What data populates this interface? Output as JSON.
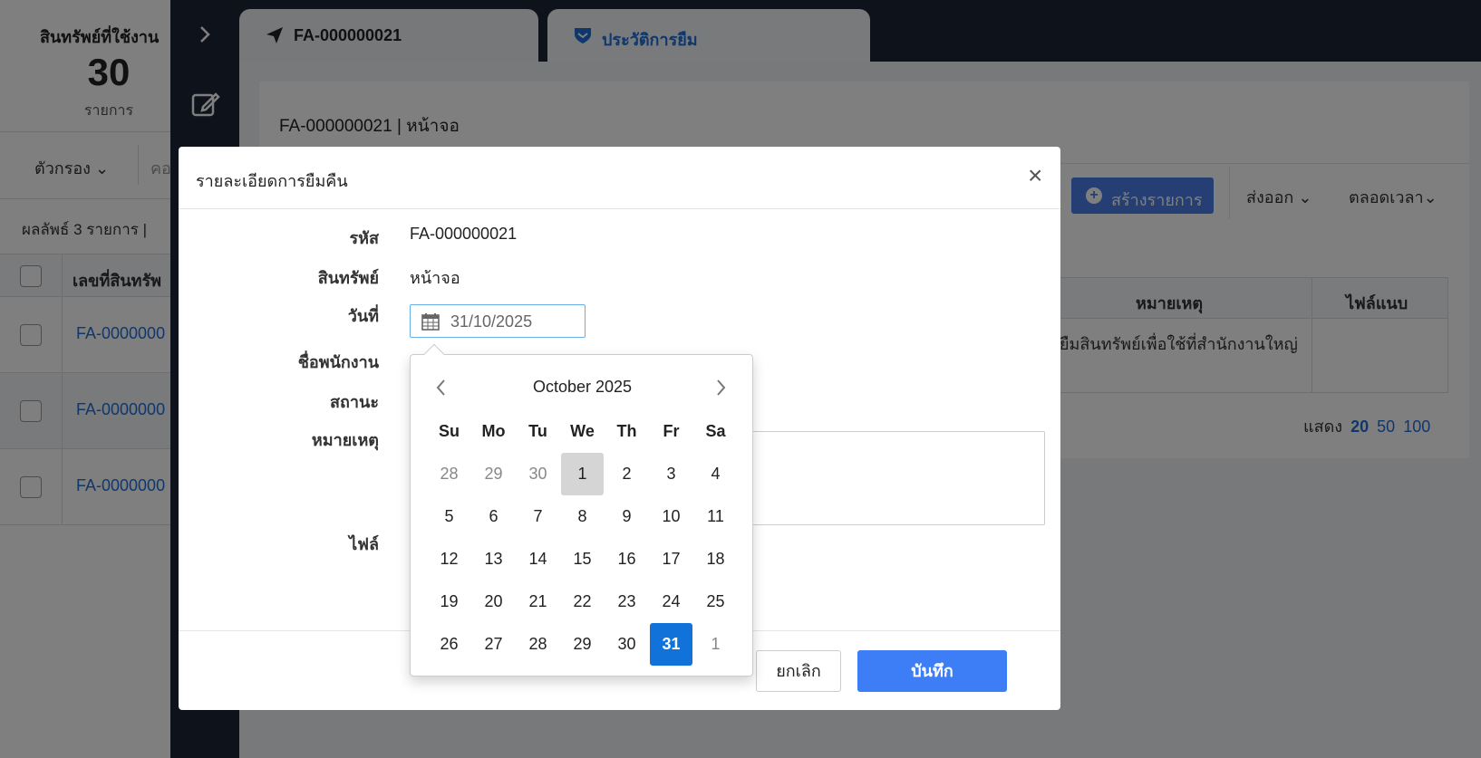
{
  "left_panel": {
    "summary_title": "สินทรัพย์ที่ใช้งาน",
    "summary_count": "30",
    "summary_unit": "รายการ",
    "filter_label": "ตัวกรอง",
    "search_placeholder": "คอ",
    "result_text": "ผลลัพธ์ 3 รายการ  |",
    "column_header": "เลขที่สินทรัพ",
    "rows": [
      "FA-0000000",
      "FA-0000000",
      "FA-0000000"
    ]
  },
  "tabs": [
    {
      "label": "FA-000000021",
      "icon": "send-icon"
    },
    {
      "label": "ประวัติการยืม",
      "icon": "shield-icon"
    }
  ],
  "card": {
    "title": "FA-000000021 | หน้าจอ",
    "create_label": "สร้างรายการ",
    "export_label": "ส่งออก",
    "time_label": "ตลอดเวลา",
    "table_headers": [
      "หมายเหตุ",
      "ไฟล์แนบ"
    ],
    "row_note": "ยืมสินทรัพย์เพื่อใช้ที่สำนักงานใหญ่",
    "pager_label": "แสดง",
    "pager_options": [
      "20",
      "50",
      "100"
    ]
  },
  "modal": {
    "title": "รายละเอียดการยืมคืน",
    "close_label": "×",
    "labels": {
      "code": "รหัส",
      "asset": "สินทรัพย์",
      "date": "วันที่",
      "employee": "ชื่อพนักงาน",
      "status": "สถานะ",
      "note": "หมายเหตุ",
      "file": "ไฟล์"
    },
    "values": {
      "code": "FA-000000021",
      "asset": "หน้าจอ",
      "date": "31/10/2025"
    },
    "cancel_label": "ยกเลิก",
    "save_label": "บันทึก"
  },
  "datepicker": {
    "month_title": "October 2025",
    "weekdays": [
      "Su",
      "Mo",
      "Tu",
      "We",
      "Th",
      "Fr",
      "Sa"
    ],
    "days": [
      {
        "d": "28",
        "muted": true
      },
      {
        "d": "29",
        "muted": true
      },
      {
        "d": "30",
        "muted": true
      },
      {
        "d": "1",
        "today": true
      },
      {
        "d": "2"
      },
      {
        "d": "3"
      },
      {
        "d": "4"
      },
      {
        "d": "5"
      },
      {
        "d": "6"
      },
      {
        "d": "7"
      },
      {
        "d": "8"
      },
      {
        "d": "9"
      },
      {
        "d": "10"
      },
      {
        "d": "11"
      },
      {
        "d": "12"
      },
      {
        "d": "13"
      },
      {
        "d": "14"
      },
      {
        "d": "15"
      },
      {
        "d": "16"
      },
      {
        "d": "17"
      },
      {
        "d": "18"
      },
      {
        "d": "19"
      },
      {
        "d": "20"
      },
      {
        "d": "21"
      },
      {
        "d": "22"
      },
      {
        "d": "23"
      },
      {
        "d": "24"
      },
      {
        "d": "25"
      },
      {
        "d": "26"
      },
      {
        "d": "27"
      },
      {
        "d": "28"
      },
      {
        "d": "29"
      },
      {
        "d": "30"
      },
      {
        "d": "31",
        "selected": true
      },
      {
        "d": "1",
        "muted": true
      }
    ]
  },
  "colors": {
    "primary": "#3d7df5",
    "selected_day": "#1172d9",
    "link": "#1e6fd9",
    "rail": "#1b2436"
  }
}
